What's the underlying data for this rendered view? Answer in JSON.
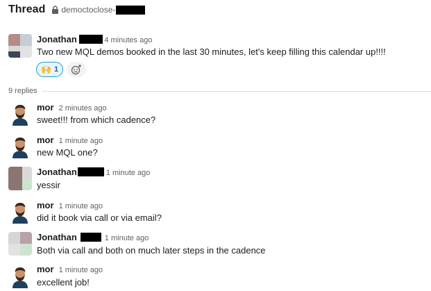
{
  "header": {
    "title": "Thread",
    "channel": "democtoclose-"
  },
  "parent": {
    "author": "Jonathan F",
    "time": "4 minutes ago",
    "text": "Two new MQL demos booked in the last 30 minutes, let's keep filling this calendar up!!!!",
    "reaction": {
      "emoji": "🙌",
      "count": "1"
    }
  },
  "replies_label": "9 replies",
  "messages": [
    {
      "author": "mor",
      "time": "2 minutes ago",
      "text": "sweet!!! from which cadence?"
    },
    {
      "author": "mor",
      "time": "1 minute ago",
      "text": "new MQL one?"
    },
    {
      "author": "Jonathan",
      "time": "1 minute ago",
      "text": "yessir"
    },
    {
      "author": "mor",
      "time": "1 minute ago",
      "text": "did it book via call or via email?"
    },
    {
      "author": "Jonathan",
      "time": "1 minute ago",
      "text": "Both via call and both on much later steps in the cadence"
    },
    {
      "author": "mor",
      "time": "1 minute ago",
      "text": "excellent job!"
    }
  ],
  "colors": {
    "link": "#1264a3",
    "reaction_border": "#1d9bd1",
    "muted_text": "#616061"
  }
}
